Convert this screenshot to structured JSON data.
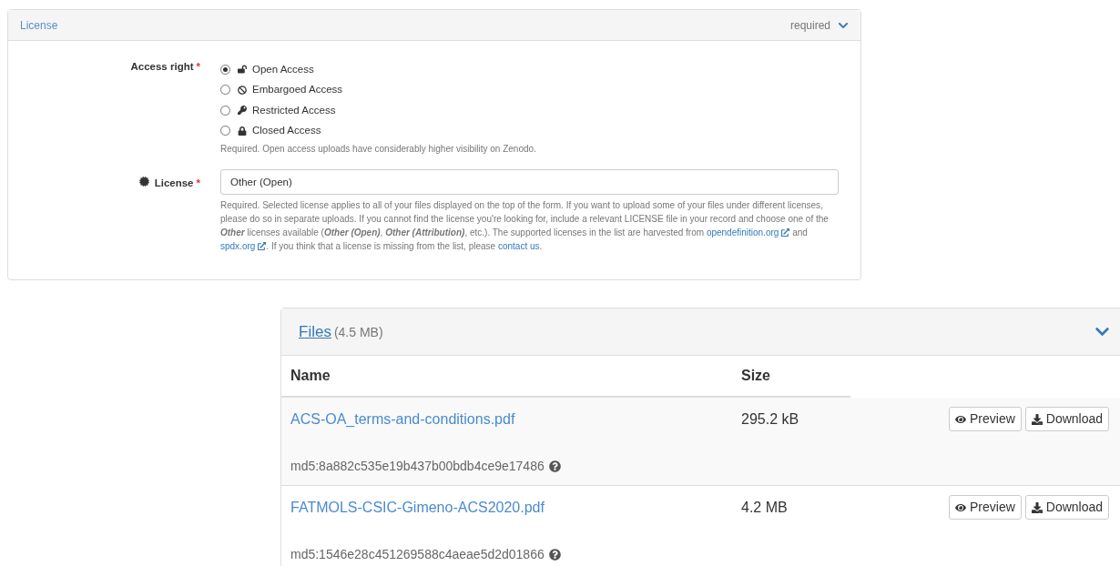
{
  "license_panel": {
    "title": "License",
    "status": "required",
    "expanded": true,
    "access_right": {
      "label": "Access right",
      "required_mark": "*",
      "options": [
        {
          "kind": "open",
          "label": "Open Access",
          "selected": true
        },
        {
          "kind": "embargoed",
          "label": "Embargoed Access",
          "selected": false
        },
        {
          "kind": "restricted",
          "label": "Restricted Access",
          "selected": false
        },
        {
          "kind": "closed",
          "label": "Closed Access",
          "selected": false
        }
      ],
      "help": "Required. Open access uploads have considerably higher visibility on Zenodo."
    },
    "license": {
      "label": "License",
      "required_mark": "*",
      "value": "Other (Open)",
      "help": [
        {
          "kind": "text",
          "text": "Required. Selected license applies to all of your files displayed on the top of the form. If you want to upload some of your files under different licenses, please do so in separate uploads. If you cannot find the license you're looking for, include a relevant LICENSE file in your record and choose one of the *Other* licenses available (*Other (Open)*, *Other (Attribution)*, etc.). The supported licenses in the list are harvested from "
        },
        {
          "kind": "external_link",
          "text": "opendefinition.org"
        },
        {
          "kind": "text",
          "text": " and "
        },
        {
          "kind": "external_link",
          "text": "spdx.org"
        },
        {
          "kind": "text",
          "text": ". If you think that a license is missing from the list, please "
        },
        {
          "kind": "link",
          "text": "contact us"
        },
        {
          "kind": "text",
          "text": "."
        }
      ]
    }
  },
  "files_panel": {
    "title": "Files",
    "size": "(4.5 MB)",
    "expanded": true,
    "columns": [
      "Name",
      "Size"
    ],
    "rows": [
      {
        "name": "ACS-OA_terms-and-conditions.pdf",
        "size": "295.2 kB",
        "checksum": "md5:8a882c535e19b437b00bdb4ce9e17486",
        "actions": [
          "Preview",
          "Download"
        ]
      },
      {
        "name": "FATMOLS-CSIC-Gimeno-ACS2020.pdf",
        "size": "4.2 MB",
        "checksum": "md5:1546e28c451269588c4aeae5d2d01866",
        "actions": [
          "Preview",
          "Download"
        ]
      }
    ]
  }
}
